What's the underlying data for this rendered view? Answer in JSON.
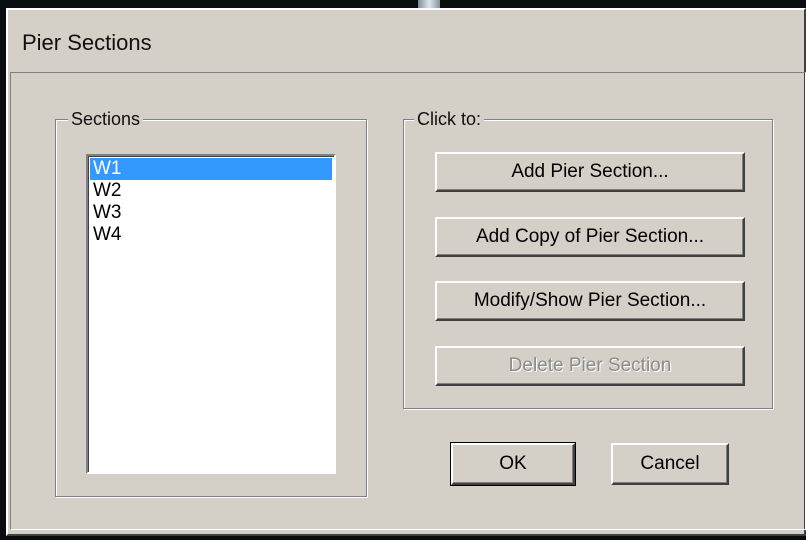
{
  "dialog": {
    "title": "Pier Sections"
  },
  "sections": {
    "label": "Sections",
    "items": [
      {
        "name": "W1",
        "selected": true
      },
      {
        "name": "W2",
        "selected": false
      },
      {
        "name": "W3",
        "selected": false
      },
      {
        "name": "W4",
        "selected": false
      }
    ]
  },
  "click_to": {
    "label": "Click to:",
    "add_label": "Add Pier Section...",
    "add_copy_label": "Add Copy of Pier Section...",
    "modify_label": "Modify/Show Pier Section...",
    "delete_label": "Delete Pier Section",
    "delete_enabled": false
  },
  "footer": {
    "ok_label": "OK",
    "cancel_label": "Cancel"
  },
  "colors": {
    "selection": "#3399ff",
    "dialog_face": "#d4d0c8"
  }
}
